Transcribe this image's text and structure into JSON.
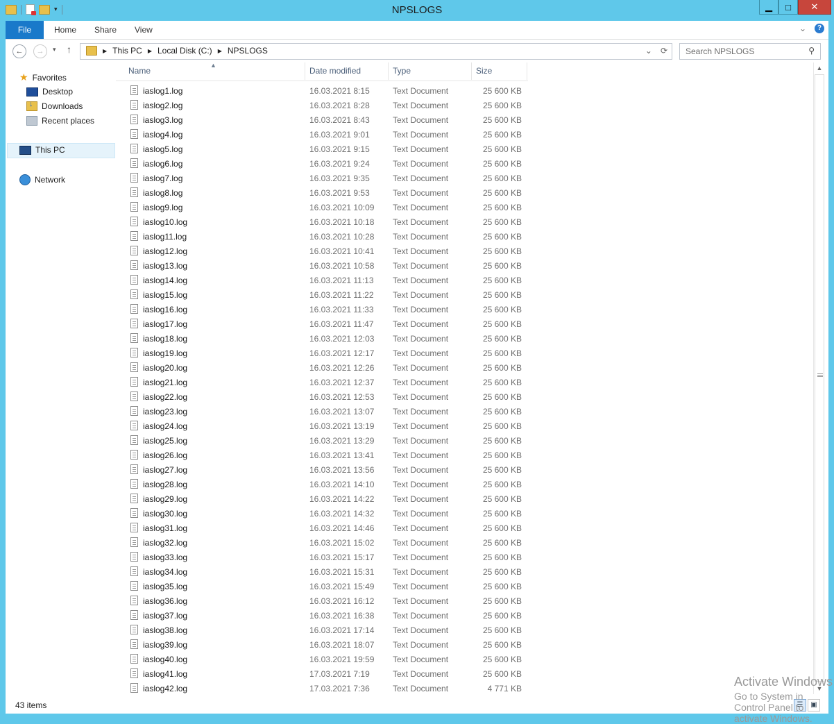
{
  "window": {
    "title": "NPSLOGS",
    "controls": {
      "minimize": "▁",
      "maximize": "□",
      "close": "✕"
    }
  },
  "ribbon": {
    "file": "File",
    "tabs": [
      "Home",
      "Share",
      "View"
    ],
    "expand_icon": "chevron-down-icon",
    "help_icon": "help-icon"
  },
  "address": {
    "crumbs": [
      "This PC",
      "Local Disk (C:)",
      "NPSLOGS"
    ],
    "dropdown_glyph": "⌄",
    "refresh_glyph": "⟳"
  },
  "search": {
    "placeholder": "Search NPSLOGS"
  },
  "nav_pane": {
    "favorites": "Favorites",
    "favorites_items": [
      "Desktop",
      "Downloads",
      "Recent places"
    ],
    "this_pc": "This PC",
    "network": "Network"
  },
  "columns": {
    "name": "Name",
    "date": "Date modified",
    "type": "Type",
    "size": "Size"
  },
  "files": [
    {
      "name": "iaslog1.log",
      "date": "16.03.2021 8:15",
      "type": "Text Document",
      "size": "25 600 KB"
    },
    {
      "name": "iaslog2.log",
      "date": "16.03.2021 8:28",
      "type": "Text Document",
      "size": "25 600 KB"
    },
    {
      "name": "iaslog3.log",
      "date": "16.03.2021 8:43",
      "type": "Text Document",
      "size": "25 600 KB"
    },
    {
      "name": "iaslog4.log",
      "date": "16.03.2021 9:01",
      "type": "Text Document",
      "size": "25 600 KB"
    },
    {
      "name": "iaslog5.log",
      "date": "16.03.2021 9:15",
      "type": "Text Document",
      "size": "25 600 KB"
    },
    {
      "name": "iaslog6.log",
      "date": "16.03.2021 9:24",
      "type": "Text Document",
      "size": "25 600 KB"
    },
    {
      "name": "iaslog7.log",
      "date": "16.03.2021 9:35",
      "type": "Text Document",
      "size": "25 600 KB"
    },
    {
      "name": "iaslog8.log",
      "date": "16.03.2021 9:53",
      "type": "Text Document",
      "size": "25 600 KB"
    },
    {
      "name": "iaslog9.log",
      "date": "16.03.2021 10:09",
      "type": "Text Document",
      "size": "25 600 KB"
    },
    {
      "name": "iaslog10.log",
      "date": "16.03.2021 10:18",
      "type": "Text Document",
      "size": "25 600 KB"
    },
    {
      "name": "iaslog11.log",
      "date": "16.03.2021 10:28",
      "type": "Text Document",
      "size": "25 600 KB"
    },
    {
      "name": "iaslog12.log",
      "date": "16.03.2021 10:41",
      "type": "Text Document",
      "size": "25 600 KB"
    },
    {
      "name": "iaslog13.log",
      "date": "16.03.2021 10:58",
      "type": "Text Document",
      "size": "25 600 KB"
    },
    {
      "name": "iaslog14.log",
      "date": "16.03.2021 11:13",
      "type": "Text Document",
      "size": "25 600 KB"
    },
    {
      "name": "iaslog15.log",
      "date": "16.03.2021 11:22",
      "type": "Text Document",
      "size": "25 600 KB"
    },
    {
      "name": "iaslog16.log",
      "date": "16.03.2021 11:33",
      "type": "Text Document",
      "size": "25 600 KB"
    },
    {
      "name": "iaslog17.log",
      "date": "16.03.2021 11:47",
      "type": "Text Document",
      "size": "25 600 KB"
    },
    {
      "name": "iaslog18.log",
      "date": "16.03.2021 12:03",
      "type": "Text Document",
      "size": "25 600 KB"
    },
    {
      "name": "iaslog19.log",
      "date": "16.03.2021 12:17",
      "type": "Text Document",
      "size": "25 600 KB"
    },
    {
      "name": "iaslog20.log",
      "date": "16.03.2021 12:26",
      "type": "Text Document",
      "size": "25 600 KB"
    },
    {
      "name": "iaslog21.log",
      "date": "16.03.2021 12:37",
      "type": "Text Document",
      "size": "25 600 KB"
    },
    {
      "name": "iaslog22.log",
      "date": "16.03.2021 12:53",
      "type": "Text Document",
      "size": "25 600 KB"
    },
    {
      "name": "iaslog23.log",
      "date": "16.03.2021 13:07",
      "type": "Text Document",
      "size": "25 600 KB"
    },
    {
      "name": "iaslog24.log",
      "date": "16.03.2021 13:19",
      "type": "Text Document",
      "size": "25 600 KB"
    },
    {
      "name": "iaslog25.log",
      "date": "16.03.2021 13:29",
      "type": "Text Document",
      "size": "25 600 KB"
    },
    {
      "name": "iaslog26.log",
      "date": "16.03.2021 13:41",
      "type": "Text Document",
      "size": "25 600 KB"
    },
    {
      "name": "iaslog27.log",
      "date": "16.03.2021 13:56",
      "type": "Text Document",
      "size": "25 600 KB"
    },
    {
      "name": "iaslog28.log",
      "date": "16.03.2021 14:10",
      "type": "Text Document",
      "size": "25 600 KB"
    },
    {
      "name": "iaslog29.log",
      "date": "16.03.2021 14:22",
      "type": "Text Document",
      "size": "25 600 KB"
    },
    {
      "name": "iaslog30.log",
      "date": "16.03.2021 14:32",
      "type": "Text Document",
      "size": "25 600 KB"
    },
    {
      "name": "iaslog31.log",
      "date": "16.03.2021 14:46",
      "type": "Text Document",
      "size": "25 600 KB"
    },
    {
      "name": "iaslog32.log",
      "date": "16.03.2021 15:02",
      "type": "Text Document",
      "size": "25 600 KB"
    },
    {
      "name": "iaslog33.log",
      "date": "16.03.2021 15:17",
      "type": "Text Document",
      "size": "25 600 KB"
    },
    {
      "name": "iaslog34.log",
      "date": "16.03.2021 15:31",
      "type": "Text Document",
      "size": "25 600 KB"
    },
    {
      "name": "iaslog35.log",
      "date": "16.03.2021 15:49",
      "type": "Text Document",
      "size": "25 600 KB"
    },
    {
      "name": "iaslog36.log",
      "date": "16.03.2021 16:12",
      "type": "Text Document",
      "size": "25 600 KB"
    },
    {
      "name": "iaslog37.log",
      "date": "16.03.2021 16:38",
      "type": "Text Document",
      "size": "25 600 KB"
    },
    {
      "name": "iaslog38.log",
      "date": "16.03.2021 17:14",
      "type": "Text Document",
      "size": "25 600 KB"
    },
    {
      "name": "iaslog39.log",
      "date": "16.03.2021 18:07",
      "type": "Text Document",
      "size": "25 600 KB"
    },
    {
      "name": "iaslog40.log",
      "date": "16.03.2021 19:59",
      "type": "Text Document",
      "size": "25 600 KB"
    },
    {
      "name": "iaslog41.log",
      "date": "17.03.2021 7:19",
      "type": "Text Document",
      "size": "25 600 KB"
    },
    {
      "name": "iaslog42.log",
      "date": "17.03.2021 7:36",
      "type": "Text Document",
      "size": "4 771 KB"
    }
  ],
  "status": {
    "item_count": "43 items"
  },
  "watermark": {
    "line1": "Activate Windows",
    "line2": "Go to System in Control Panel to activate Windows."
  },
  "colors": {
    "titlebar": "#5fc8ea",
    "file_tab": "#1979ca",
    "close_button": "#c7463c"
  }
}
